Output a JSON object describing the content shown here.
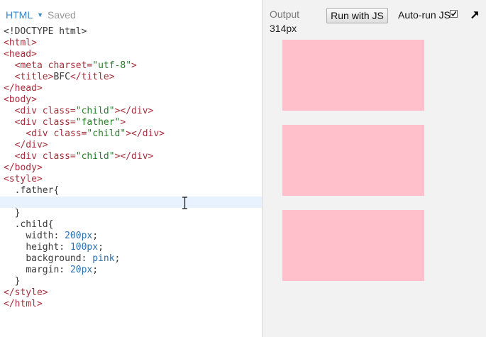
{
  "editor": {
    "language": "HTML",
    "status": "Saved"
  },
  "output": {
    "title": "Output",
    "width_readout": "314px",
    "run_button_label": "Run with JS",
    "autorun_label": "Auto-run JS",
    "autorun_checked": true
  },
  "code": {
    "lines": {
      "l1": "<!DOCTYPE html>",
      "l2_tag": "<html>",
      "l3_tag": "<head>",
      "l4_tag_open": "<meta",
      "l4_attr": "charset=",
      "l4_str": "\"utf-8\"",
      "l4_tag_close": ">",
      "l5_tag_open": "<title>",
      "l5_text": "BFC",
      "l5_tag_close": "</title>",
      "l6_tag": "</head>",
      "l7_tag": "<body>",
      "div_open": "<div",
      "class_attr": "class=",
      "child_str": "\"child\"",
      "father_str": "\"father\"",
      "close_gt": ">",
      "div_close": "</div>",
      "l14_tag": "</body>",
      "l15_tag": "<style>",
      "l16_sel": ".father{",
      "l18_brace": "}",
      "l19_sel": ".child{",
      "l20_prop": "width: ",
      "l20_val": "200px",
      "l21_prop": "height: ",
      "l21_val": "100px",
      "l22_prop": "background: ",
      "l22_val": "pink",
      "l23_prop": "margin: ",
      "l23_val": "20px",
      "semi": ";",
      "l24_brace": "}",
      "l25_tag": "</style>",
      "l26_tag": "</html>"
    }
  },
  "preview": {
    "box_color": "#ffc0cb",
    "boxes": [
      "child",
      "father > child",
      "child"
    ]
  },
  "icons": {
    "popout": "popout-arrow-icon",
    "cursor": "text-cursor-icon"
  }
}
